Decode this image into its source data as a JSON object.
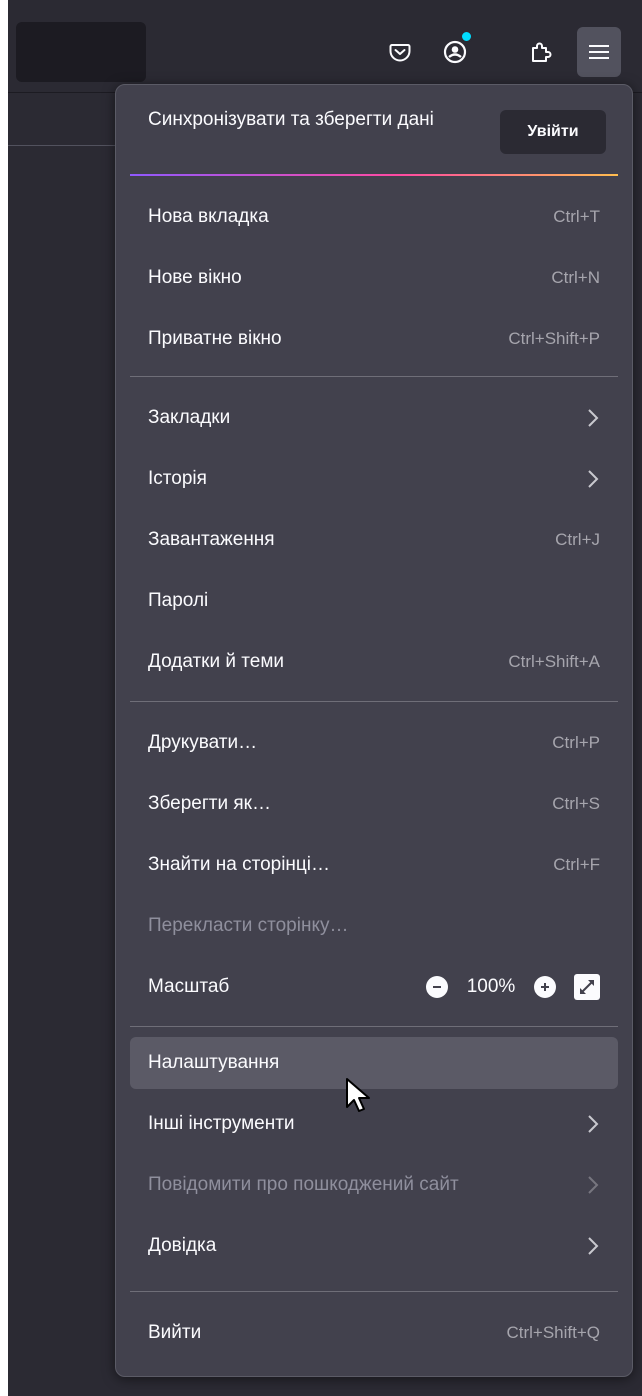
{
  "toolbar": {
    "icons": [
      "pocket-icon",
      "account-icon",
      "extensions-icon",
      "hamburger-menu-icon"
    ]
  },
  "menu": {
    "sync_text": "Синхронізувати та зберегти дані",
    "signin_label": "Увійти",
    "items": [
      {
        "label": "Нова вкладка",
        "shortcut": "Ctrl+T"
      },
      {
        "label": "Нове вікно",
        "shortcut": "Ctrl+N"
      },
      {
        "label": "Приватне вікно",
        "shortcut": "Ctrl+Shift+P"
      },
      {
        "label": "Закладки",
        "submenu": true
      },
      {
        "label": "Історія",
        "submenu": true
      },
      {
        "label": "Завантаження",
        "shortcut": "Ctrl+J"
      },
      {
        "label": "Паролі"
      },
      {
        "label": "Додатки й теми",
        "shortcut": "Ctrl+Shift+A"
      },
      {
        "label": "Друкувати…",
        "shortcut": "Ctrl+P"
      },
      {
        "label": "Зберегти як…",
        "shortcut": "Ctrl+S"
      },
      {
        "label": "Знайти на сторінці…",
        "shortcut": "Ctrl+F"
      },
      {
        "label": "Перекласти сторінку…",
        "disabled": true
      },
      {
        "label": "Масштаб",
        "zoom": "100%"
      },
      {
        "label": "Налаштування",
        "hovered": true
      },
      {
        "label": "Інші інструменти",
        "submenu": true
      },
      {
        "label": "Повідомити про пошкоджений сайт",
        "submenu": true,
        "disabled": true
      },
      {
        "label": "Довідка",
        "submenu": true
      },
      {
        "label": "Вийти",
        "shortcut": "Ctrl+Shift+Q"
      }
    ]
  },
  "colors": {
    "accent_dot": "#00ddff",
    "panel_bg": "#42414d",
    "hover_bg": "#5b5a66"
  }
}
